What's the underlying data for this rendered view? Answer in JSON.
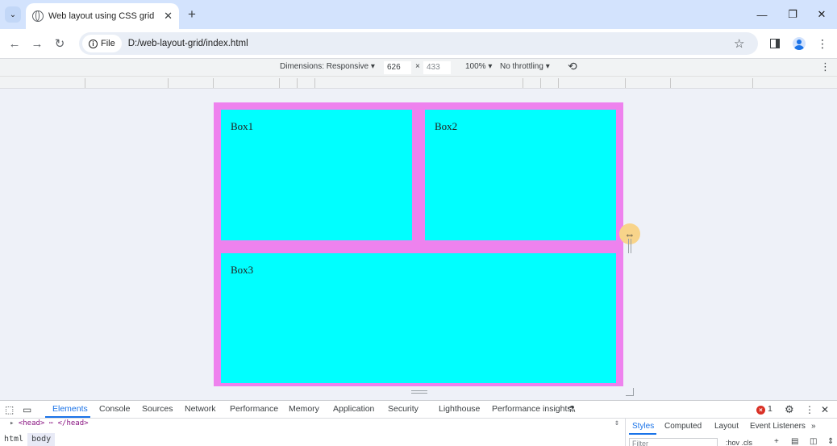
{
  "browser": {
    "tab_title": "Web layout using CSS grid",
    "tab_close": "✕",
    "new_tab": "+",
    "window_controls": {
      "minimize": "—",
      "restore": "❐",
      "close": "✕"
    },
    "address": {
      "chip_label": "File",
      "url": "D:/web-layout-grid/index.html"
    }
  },
  "device_toolbar": {
    "dimensions_label": "Dimensions: Responsive ▾",
    "width": "626",
    "times": "×",
    "height": "433",
    "zoom": "100% ▾",
    "throttling": "No throttling ▾"
  },
  "page": {
    "box1": "Box1",
    "box2": "Box2",
    "box3": "Box3",
    "colors": {
      "container": "#ee82ee",
      "box": "#00ffff"
    }
  },
  "devtools": {
    "tabs": [
      "Elements",
      "Console",
      "Sources",
      "Network",
      "Performance",
      "Memory",
      "Application",
      "Security",
      "Lighthouse",
      "Performance insights"
    ],
    "error_count": "1",
    "dom_line1": "<head> ⋯ </head>",
    "styles_tabs": [
      "Styles",
      "Computed",
      "Layout",
      "Event Listeners"
    ],
    "filter_placeholder": "Filter",
    "styles_actions": ":hov .cls",
    "breadcrumbs": [
      "html",
      "body"
    ]
  }
}
